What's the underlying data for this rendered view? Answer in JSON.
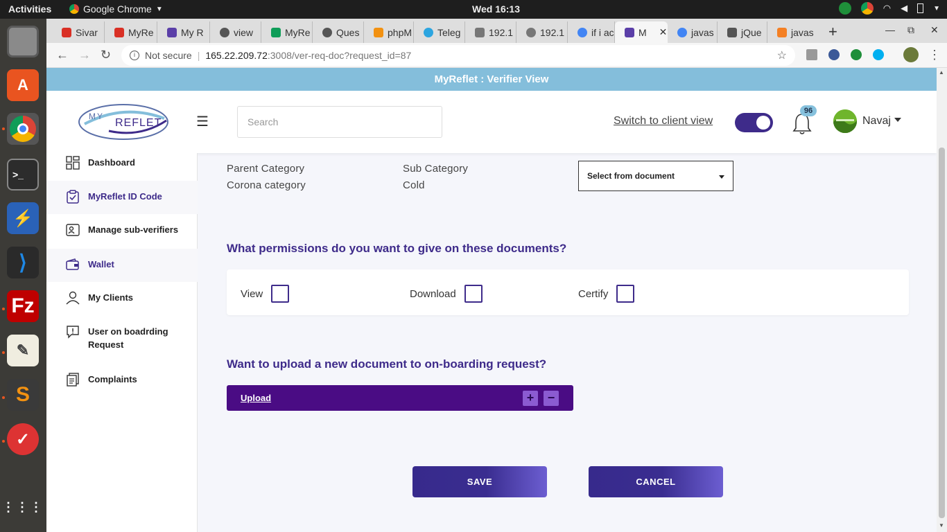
{
  "system": {
    "activities": "Activities",
    "app_name": "Google Chrome",
    "clock": "Wed 16:13"
  },
  "browser": {
    "tabs": [
      {
        "label": "Sivar",
        "color": "#d93025"
      },
      {
        "label": "MyRe",
        "color": "#d93025"
      },
      {
        "label": "My R",
        "color": "#5b3fa8"
      },
      {
        "label": "view",
        "color": "#555555"
      },
      {
        "label": "MyRe",
        "color": "#0f9d58"
      },
      {
        "label": "Ques",
        "color": "#555555"
      },
      {
        "label": "phpM",
        "color": "#f29111"
      },
      {
        "label": "Teleg",
        "color": "#2ca5e0"
      },
      {
        "label": "192.1",
        "color": "#777777"
      },
      {
        "label": "192.1",
        "color": "#777777"
      },
      {
        "label": "if i ac",
        "color": "#4285f4"
      },
      {
        "label": "M",
        "color": "#5b3fa8"
      },
      {
        "label": "javas",
        "color": "#4285f4"
      },
      {
        "label": "jQue",
        "color": "#555555"
      },
      {
        "label": "javas",
        "color": "#f48024"
      }
    ],
    "new_tab": "+",
    "url_security": "Not secure",
    "url_host": "165.22.209.72",
    "url_path": ":3008/ver-req-doc?request_id=87"
  },
  "app": {
    "banner": "MyReflet : Verifier View",
    "logo_top": "MY",
    "logo_main": "REFLET",
    "search_placeholder": "Search",
    "switch_link": "Switch to client view",
    "notification_count": "96",
    "user_name": "Navaj"
  },
  "sidebar": {
    "items": [
      {
        "label": "Dashboard",
        "icon": "dashboard-icon"
      },
      {
        "label": "MyReflet ID Code",
        "icon": "clipboard-check-icon"
      },
      {
        "label": "Manage sub-verifiers",
        "icon": "id-card-icon"
      },
      {
        "label": "Wallet",
        "icon": "wallet-icon"
      },
      {
        "label": "My Clients",
        "icon": "user-icon"
      },
      {
        "label": "User on boadrding Request",
        "icon": "alert-icon"
      },
      {
        "label": "Complaints",
        "icon": "documents-icon"
      }
    ]
  },
  "main": {
    "parent_category_label": "Parent Category",
    "parent_category_value": "Corona category",
    "sub_category_label": "Sub Category",
    "sub_category_value": "Cold",
    "select_document": "Select from document",
    "permissions_title": "What permissions do you want to give on these documents?",
    "permissions": [
      {
        "label": "View",
        "checked": false
      },
      {
        "label": "Download",
        "checked": false
      },
      {
        "label": "Certify",
        "checked": false
      }
    ],
    "upload_title": "Want to upload a new document to on-boarding request?",
    "upload_label": "Upload",
    "plus": "+",
    "minus": "−",
    "save": "SAVE",
    "cancel": "CANCEL"
  }
}
